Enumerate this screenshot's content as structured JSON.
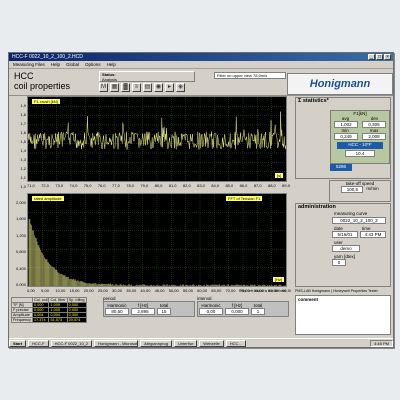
{
  "window": {
    "title": "HCC-F  0022_10_2_100_2.HCD"
  },
  "menu": [
    "Measuring Files",
    "Help"
  ],
  "menu_mid": [
    "Global",
    "Options",
    "Help"
  ],
  "app": {
    "title_line1": "HCC",
    "title_line2": "coil properties"
  },
  "status": {
    "label": "Status:",
    "value": "Analysis"
  },
  "filter_info": "Filter on upper view 78,0m/s",
  "brand": "Honigmann",
  "toolbar": [
    "M",
    "▦",
    "▓",
    "≡",
    "▤",
    "◉",
    "▸",
    "◈"
  ],
  "plot_top": {
    "label": "F1 crush [kN]",
    "y_ticks": [
      "1,9",
      "1,8",
      "1,7",
      "1,6",
      "1,5",
      "1,4",
      "1,3",
      "1,2",
      "1,1",
      "1,0"
    ],
    "x_ticks": [
      "71,0",
      "72,0",
      "73,0",
      "74,0",
      "75,0",
      "76,0",
      "77,0",
      "78,0",
      "79,0",
      "80,0",
      "81,0",
      "82,0",
      "83,0",
      "84,0",
      "85,0",
      "86,0",
      "87,0",
      "88,0",
      "89,0"
    ],
    "unit_marker": "[s]"
  },
  "plot_bottom": {
    "label": "rated amplitude",
    "label_right": "FFT of Tension F1",
    "y_ticks": [
      "2,000",
      "1,600",
      "1,200",
      "0,800",
      "0,400",
      "0,000"
    ],
    "x_ticks": [
      "0,00",
      "5,00",
      "10,00",
      "15,00",
      "20,00",
      "25,00",
      "30,00",
      "35,00",
      "40,00",
      "45,00",
      "50,00",
      "55,00",
      "60,00",
      "65,00",
      "70,00",
      "75,00",
      "80,00",
      "85,00",
      "90,00"
    ],
    "unit_marker": "[Hz]"
  },
  "statistics": {
    "title": "Σ statistics*",
    "unit": "F1[kN]",
    "rows": [
      {
        "name": "avg",
        "col_a": "1,002",
        "name_b": "dev",
        "col_b": "0,305"
      },
      {
        "name": "min",
        "col_a": "0,249",
        "name_b": "max",
        "col_b": "2,008"
      }
    ],
    "hcc_label": "HCC - 10*F",
    "hcc_value": "10.4",
    "info_field": "5286"
  },
  "speed": {
    "label": "take-off speed",
    "value": "100,5",
    "unit": "m/min"
  },
  "administration": {
    "title": "administration",
    "measuring_curve_label": "measuring curve",
    "measuring_curve": "0022_10_2_100_2",
    "date_label": "date",
    "date": "5/16/01",
    "time_label": "time",
    "time": "4:43 PM",
    "user_label": "user",
    "user": "demo",
    "yarn_label": "yarn [dtex]",
    "yarn": "0"
  },
  "bottom_table": {
    "headers": [
      "",
      "Col. coil",
      "Col. fiber",
      "Sp. Idling",
      "MResoror"
    ],
    "rows": [
      [
        "TF [N]",
        "0,000",
        "1,009",
        "0,000"
      ],
      [
        "F precise",
        "0,000",
        "1,000",
        "0,000"
      ],
      [
        "Amplitude",
        "0,004",
        "0,004",
        "0,300"
      ],
      [
        "Frequency",
        "17,374",
        "51,573",
        "20,574"
      ]
    ]
  },
  "period": {
    "label": "period",
    "a_label": "Harmonic",
    "a": "80,50",
    "b_label": "f [Hz]",
    "b": "2,895",
    "c_label": "total",
    "c": "15"
  },
  "interval": {
    "label": "interval",
    "a_label": "Harmonic",
    "a": "0,00",
    "b_label": "f [Hz]",
    "b": "0,000",
    "c_label": "total",
    "c": "1"
  },
  "notes": "Pnts. left: value is not defined",
  "copyright": "PMS-LAB Honigmann | Honeywell Properties Tester",
  "comment_label": "comment",
  "taskbar": {
    "start": "Start",
    "tasks": [
      "HCC-F",
      "HCC-F  0022_10_2",
      "Honigmann - Microsoft",
      "Abspannprog",
      "Unterflur",
      "Webzelle",
      "HCC..."
    ],
    "clock": "4:45 PM"
  },
  "colors": {
    "trace": "#f4f48a",
    "plot_bg": "#000000",
    "grid": "#3c6e3c",
    "window": "#d4d0c8",
    "accent": "#1f5aa8"
  }
}
